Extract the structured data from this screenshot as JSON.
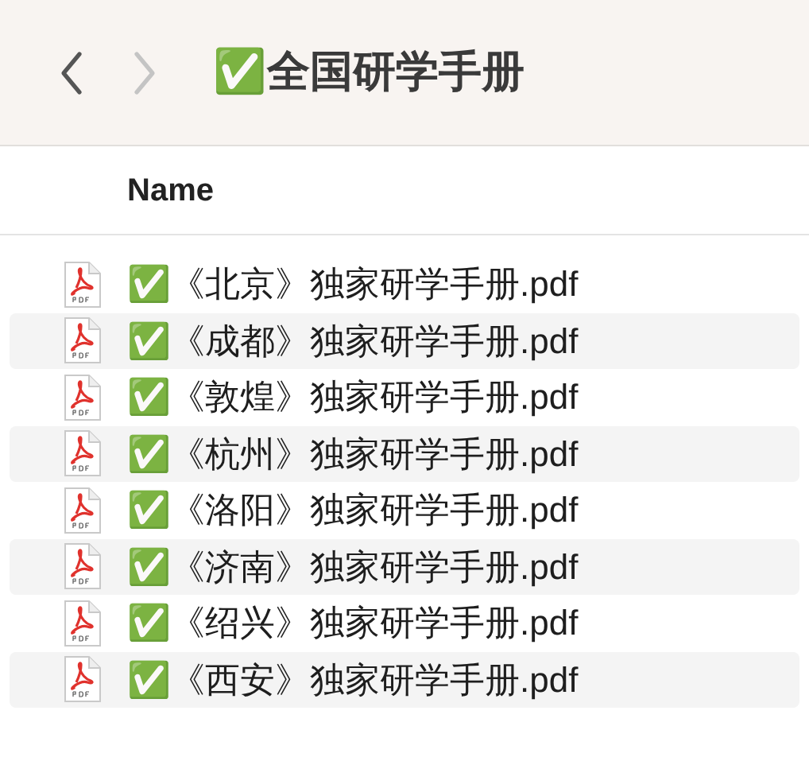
{
  "toolbar": {
    "back_enabled": true,
    "forward_enabled": false,
    "title": "✅全国研学手册"
  },
  "table": {
    "columns": [
      "Name"
    ],
    "rows": [
      {
        "name": "✅《北京》独家研学手册.pdf"
      },
      {
        "name": "✅《成都》独家研学手册.pdf"
      },
      {
        "name": "✅《敦煌》独家研学手册.pdf"
      },
      {
        "name": "✅《杭州》独家研学手册.pdf"
      },
      {
        "name": "✅《洛阳》独家研学手册.pdf"
      },
      {
        "name": "✅《济南》独家研学手册.pdf"
      },
      {
        "name": "✅《绍兴》独家研学手册.pdf"
      },
      {
        "name": "✅《西安》独家研学手册.pdf"
      }
    ]
  }
}
